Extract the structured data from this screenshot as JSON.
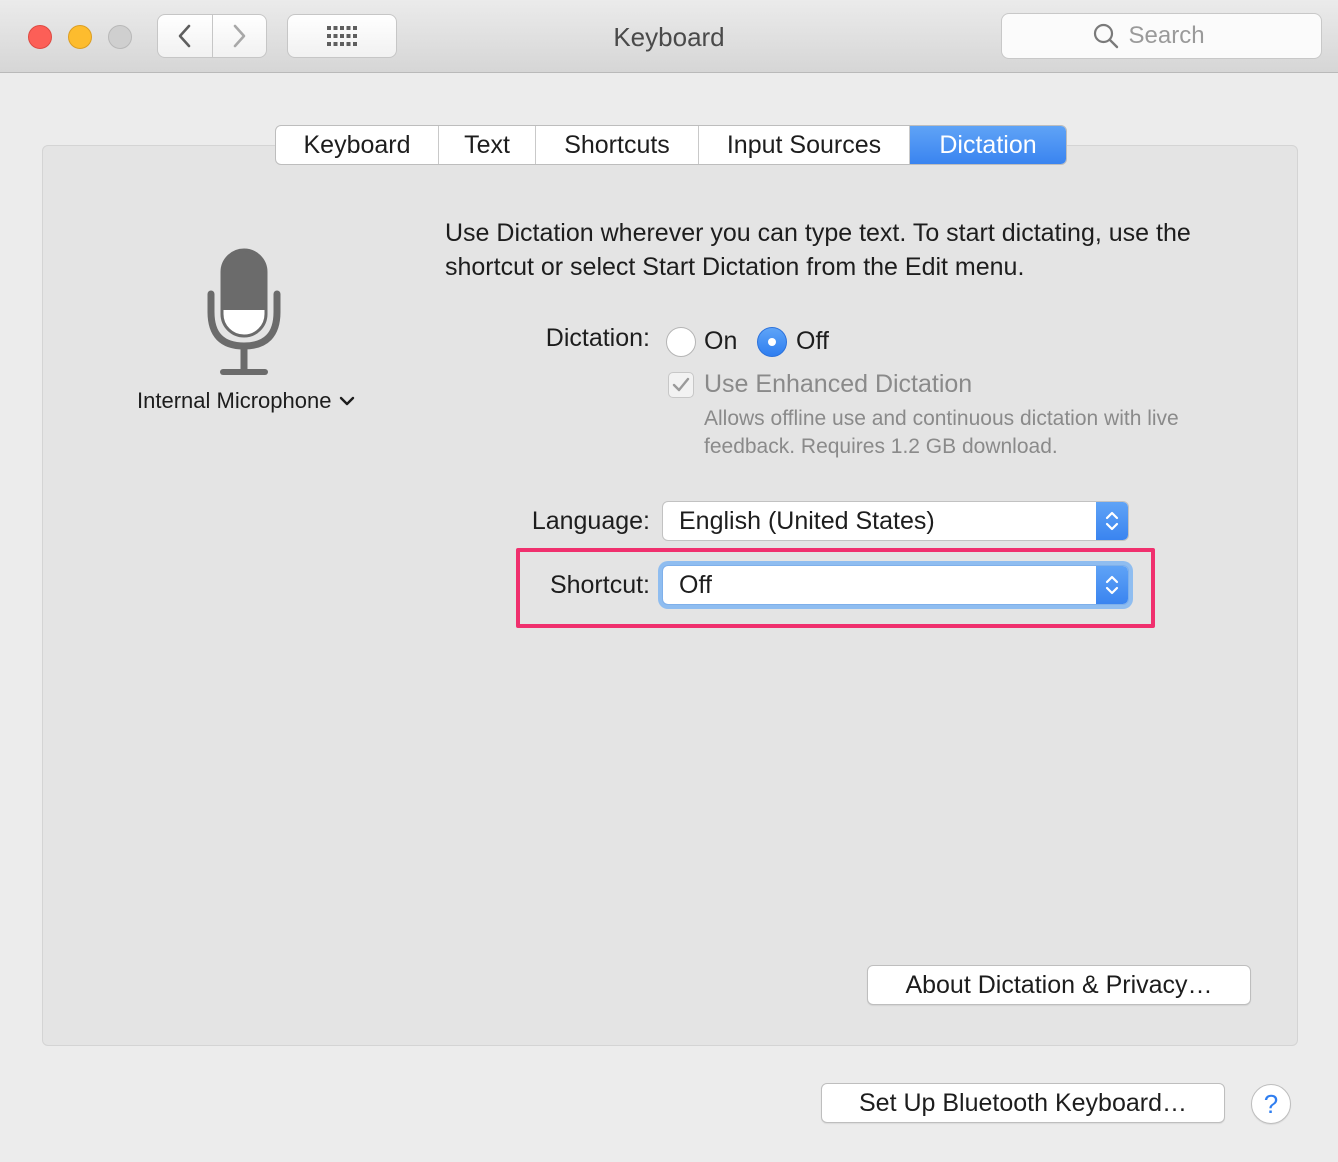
{
  "window": {
    "title": "Keyboard",
    "search_placeholder": "Search"
  },
  "toolbar": {
    "back_icon": "chevron-left-icon",
    "forward_icon": "chevron-right-icon",
    "show_all_icon": "grid-icon"
  },
  "tabs": [
    {
      "label": "Keyboard",
      "active": false
    },
    {
      "label": "Text",
      "active": false
    },
    {
      "label": "Shortcuts",
      "active": false
    },
    {
      "label": "Input Sources",
      "active": false
    },
    {
      "label": "Dictation",
      "active": true
    }
  ],
  "dictation": {
    "description": "Use Dictation wherever you can type text. To start dictating, use the shortcut or select Start Dictation from the Edit menu.",
    "microphone_source": "Internal Microphone",
    "dictation_label": "Dictation:",
    "on_label": "On",
    "off_label": "Off",
    "selected": "Off",
    "enhanced_label": "Use Enhanced Dictation",
    "enhanced_checked": true,
    "enhanced_enabled": false,
    "enhanced_description": "Allows offline use and continuous dictation with live feedback. Requires 1.2 GB download.",
    "language_label": "Language:",
    "language_value": "English (United States)",
    "shortcut_label": "Shortcut:",
    "shortcut_value": "Off",
    "about_button": "About Dictation & Privacy…"
  },
  "footer": {
    "bluetooth_button": "Set Up Bluetooth Keyboard…",
    "help_label": "?"
  },
  "colors": {
    "accent": "#3a84f0",
    "highlight_box": "#f0306e"
  }
}
